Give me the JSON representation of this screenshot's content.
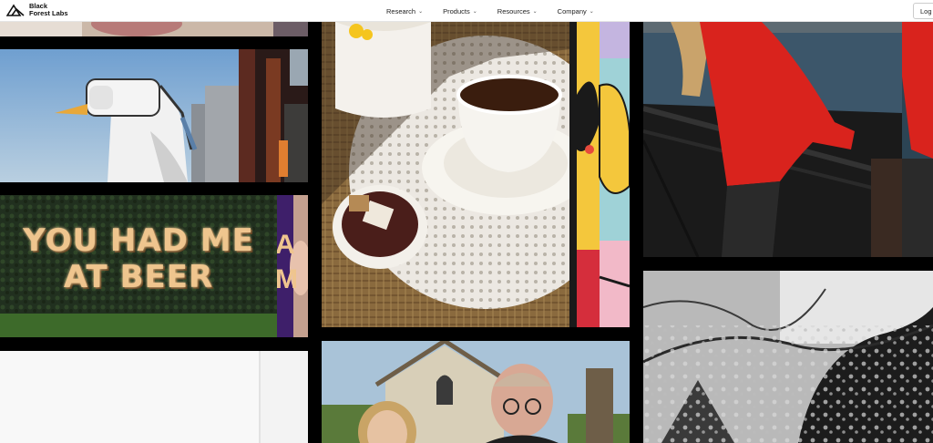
{
  "header": {
    "brand_line1": "Black",
    "brand_line2": "Forest Labs",
    "login_label": "Log",
    "nav": [
      {
        "label": "Research"
      },
      {
        "label": "Products"
      },
      {
        "label": "Resources"
      },
      {
        "label": "Company"
      }
    ]
  },
  "icons": {
    "logo": "triangle-mountain-logo-icon",
    "dropdown": "chevron-down-icon"
  },
  "gallery": {
    "sign_text_line1": "YOU HAD ME",
    "sign_text_line2": "AT BEER",
    "sign_partial_line1": "A",
    "sign_partial_line2": "M"
  },
  "colors": {
    "background": "#000000",
    "header_bg": "#ffffff",
    "red_jacket": "#d9231d",
    "marquee_bulb": "#f2c98a"
  }
}
